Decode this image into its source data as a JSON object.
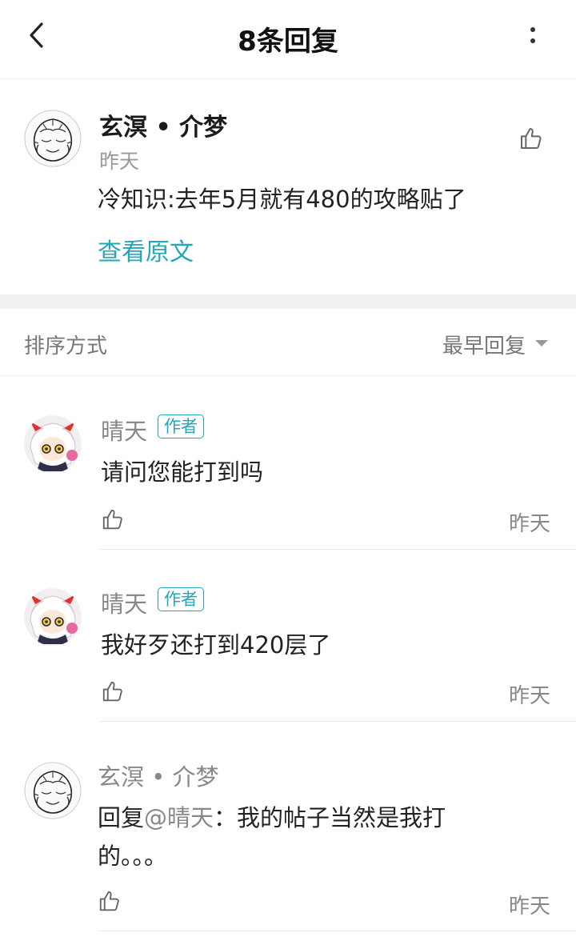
{
  "header": {
    "title": "8条回复",
    "back_icon": "chevron-left-icon",
    "more_icon": "more-vertical-icon"
  },
  "original_post": {
    "author": "玄溟 • 介梦",
    "time": "昨天",
    "text": "冷知识:去年5月就有480的攻略贴了",
    "view_original": "查看原文"
  },
  "sort": {
    "label": "排序方式",
    "value": "最早回复"
  },
  "replies": [
    {
      "author": "晴天",
      "badge": "作者",
      "text": "请问您能打到吗",
      "time": "昨天"
    },
    {
      "author": "晴天",
      "badge": "作者",
      "text": "我好歹还打到420层了",
      "time": "昨天"
    },
    {
      "author": "玄溟 • 介梦",
      "mention_prefix": "回复",
      "mention": "@晴天",
      "text_line1": "：我的帖子当然是我打",
      "text_line2": "的。。。",
      "time": "昨天"
    }
  ],
  "colors": {
    "accent": "#21a9b8",
    "muted_text": "#888888",
    "separator_band": "#f1f1f1"
  }
}
